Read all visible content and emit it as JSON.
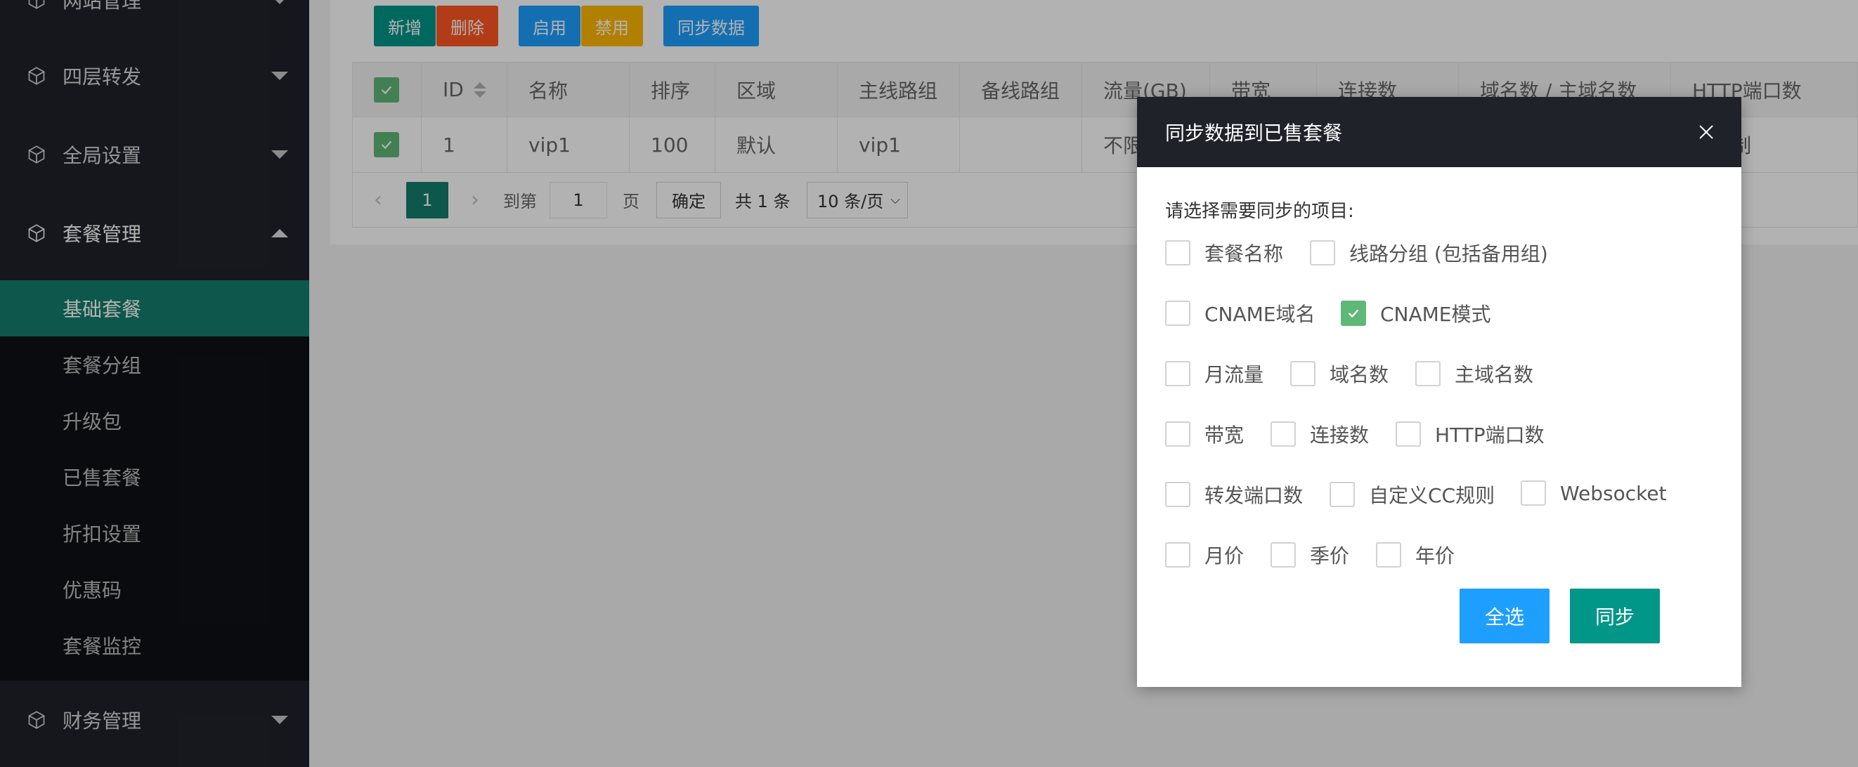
{
  "colors": {
    "sidebar_bg": "#20222a",
    "submenu_bg": "#0f1115",
    "active": "#147d6e",
    "teal": "#009688",
    "red": "#ff5722",
    "blue": "#1e9fff",
    "orange": "#ffb800",
    "checked": "#5fb878"
  },
  "sidebar": {
    "groups": [
      {
        "label": "网站管理",
        "icon": "cube-icon",
        "arrow": "down"
      },
      {
        "label": "四层转发",
        "icon": "cube-icon",
        "arrow": "down"
      },
      {
        "label": "全局设置",
        "icon": "cube-icon",
        "arrow": "down"
      },
      {
        "label": "套餐管理",
        "icon": "cube-icon",
        "arrow": "up"
      },
      {
        "label": "财务管理",
        "icon": "cube-icon",
        "arrow": "down"
      }
    ],
    "sub_items": [
      "基础套餐",
      "套餐分组",
      "升级包",
      "已售套餐",
      "折扣设置",
      "优惠码",
      "套餐监控"
    ],
    "active_sub": "基础套餐"
  },
  "toolbar": {
    "add": "新增",
    "delete": "删除",
    "enable": "启用",
    "disable": "禁用",
    "sync": "同步数据"
  },
  "table": {
    "columns": [
      "ID",
      "名称",
      "排序",
      "区域",
      "主线路组",
      "备线路组",
      "流量(GB)",
      "带宽",
      "连接数",
      "域名数 / 主域名数",
      "HTTP端口数"
    ],
    "row": [
      "1",
      "vip1",
      "100",
      "默认",
      "vip1",
      "",
      "不限",
      "",
      "",
      "",
      "不限制"
    ]
  },
  "pager": {
    "current": "1",
    "goto": "到第",
    "page_input": "1",
    "page_unit": "页",
    "confirm": "确定",
    "total": "共 1 条",
    "per_page": "10 条/页"
  },
  "modal": {
    "title": "同步数据到已售套餐",
    "prompt": "请选择需要同步的项目:",
    "options": [
      {
        "label": "套餐名称",
        "checked": false
      },
      {
        "label": "线路分组 (包括备用组)",
        "checked": false
      },
      {
        "label": "CNAME域名",
        "checked": false
      },
      {
        "label": "CNAME模式",
        "checked": true
      },
      {
        "label": "月流量",
        "checked": false
      },
      {
        "label": "域名数",
        "checked": false
      },
      {
        "label": "主域名数",
        "checked": false
      },
      {
        "label": "带宽",
        "checked": false
      },
      {
        "label": "连接数",
        "checked": false
      },
      {
        "label": "HTTP端口数",
        "checked": false
      },
      {
        "label": "转发端口数",
        "checked": false
      },
      {
        "label": "自定义CC规则",
        "checked": false
      },
      {
        "label": "Websocket",
        "checked": false
      },
      {
        "label": "月价",
        "checked": false
      },
      {
        "label": "季价",
        "checked": false
      },
      {
        "label": "年价",
        "checked": false
      }
    ],
    "select_all": "全选",
    "sync": "同步"
  }
}
